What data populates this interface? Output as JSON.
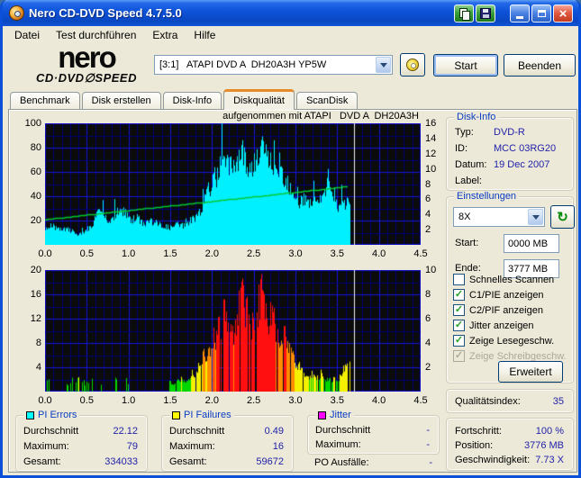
{
  "window": {
    "title": "Nero CD-DVD Speed 4.7.5.0"
  },
  "menu": {
    "items": [
      "Datei",
      "Test durchführen",
      "Extra",
      "Hilfe"
    ]
  },
  "header": {
    "logo_line1": "nero",
    "logo_line2": "CD·DVD∅SPEED",
    "drive_value": "[3:1]   ATAPI DVD A  DH20A3H YP5W",
    "start_label": "Start",
    "quit_label": "Beenden"
  },
  "tabs": [
    "Benchmark",
    "Disk erstellen",
    "Disk-Info",
    "Diskqualität",
    "ScanDisk"
  ],
  "active_tab": "Diskqualität",
  "charts_header": "aufgenommen mit ATAPI   DVD A  DH20A3H",
  "disk_info": {
    "title": "Disk-Info",
    "rows": [
      {
        "label": "Typ:",
        "value": "DVD-R"
      },
      {
        "label": "ID:",
        "value": "MCC 03RG20"
      },
      {
        "label": "Datum:",
        "value": "19 Dec 2007"
      },
      {
        "label": "Label:",
        "value": ""
      }
    ]
  },
  "settings": {
    "title": "Einstellungen",
    "speed_value": "8X",
    "start_label": "Start:",
    "start_value": "0000 MB",
    "end_label": "Ende:",
    "end_value": "3777 MB",
    "checkboxes": [
      {
        "label": "Schnelles Scannen",
        "checked": false,
        "disabled": false
      },
      {
        "label": "C1/PIE anzeigen",
        "checked": true,
        "disabled": false
      },
      {
        "label": "C2/PIF anzeigen",
        "checked": true,
        "disabled": false
      },
      {
        "label": "Jitter anzeigen",
        "checked": true,
        "disabled": false
      },
      {
        "label": "Zeige Lesegeschw.",
        "checked": true,
        "disabled": false
      },
      {
        "label": "Zeige Schreibgeschw.",
        "checked": true,
        "disabled": true
      }
    ],
    "advanced_label": "Erweitert"
  },
  "quality": {
    "label": "Qualitätsindex:",
    "value": "35"
  },
  "progress": {
    "rows": [
      {
        "label": "Fortschritt:",
        "value": "100 %"
      },
      {
        "label": "Position:",
        "value": "3776 MB"
      },
      {
        "label": "Geschwindigkeit:",
        "value": "7.73 X"
      }
    ]
  },
  "stats": {
    "pi_errors": {
      "title": "PI Errors",
      "color": "#00FFFF",
      "rows": [
        {
          "label": "Durchschnitt",
          "value": "22.12"
        },
        {
          "label": "Maximum:",
          "value": "79"
        },
        {
          "label": "Gesamt:",
          "value": "334033"
        }
      ]
    },
    "pi_failures": {
      "title": "PI Failures",
      "color": "#FFFF00",
      "rows": [
        {
          "label": "Durchschnitt",
          "value": "0.49"
        },
        {
          "label": "Maximum:",
          "value": "16"
        },
        {
          "label": "Gesamt:",
          "value": "59672"
        }
      ]
    },
    "jitter": {
      "title": "Jitter",
      "color": "#FF00FF",
      "rows": [
        {
          "label": "Durchschnitt",
          "value": "-"
        },
        {
          "label": "Maximum:",
          "value": "-"
        }
      ]
    },
    "po_label": "PO Ausfälle:",
    "po_value": "-"
  },
  "chart_data": [
    {
      "id": "pie",
      "type": "area",
      "series_name": "PI Errors",
      "title": "aufgenommen mit ATAPI   DVD A  DH20A3H",
      "xlim": [
        0,
        4.5
      ],
      "x_step": 0.05,
      "x_data_end": 3.65,
      "x_ticks": [
        "0.0",
        "0.5",
        "1.0",
        "1.5",
        "2.0",
        "2.5",
        "3.0",
        "3.5",
        "4.0",
        "4.5"
      ],
      "ylim": [
        0,
        100
      ],
      "y_ticks_left": [
        100,
        80,
        60,
        40,
        20
      ],
      "y2lim": [
        0,
        16
      ],
      "y_ticks_right": [
        16,
        14,
        12,
        10,
        8,
        6,
        4,
        2
      ],
      "values": [
        14,
        13,
        15,
        13,
        12,
        13,
        12,
        10,
        8,
        10,
        13,
        15,
        22,
        28,
        24,
        21,
        22,
        25,
        30,
        26,
        22,
        21,
        22,
        19,
        18,
        20,
        19,
        17,
        16,
        15,
        14,
        16,
        17,
        16,
        18,
        20,
        23,
        28,
        35,
        44,
        52,
        57,
        63,
        66,
        61,
        67,
        72,
        78,
        71,
        64,
        67,
        71,
        79,
        73,
        68,
        66,
        63,
        58,
        54,
        46,
        41,
        36,
        38,
        34,
        37,
        33,
        36,
        44,
        57,
        37,
        31,
        30,
        35,
        31
      ],
      "speed_line": {
        "name": "Lesegeschwindigkeit",
        "start_x": 0,
        "start_speed": 3.35,
        "end_x": 3.65,
        "end_speed": 7.73
      },
      "marker_x": 3.7,
      "colors": {
        "fill": "#00F0FF",
        "speed": "#00C832",
        "marker": "#F2F2F2",
        "bg": "#0B0B0B",
        "grid_major": "#1414DC",
        "grid_minor": "#000072"
      }
    },
    {
      "id": "pif",
      "type": "bar",
      "series_name": "PI Failures",
      "xlim": [
        0,
        4.5
      ],
      "x_step": 0.05,
      "x_data_end": 3.65,
      "x_ticks": [
        "0.0",
        "0.5",
        "1.0",
        "1.5",
        "2.0",
        "2.5",
        "3.0",
        "3.5",
        "4.0",
        "4.5"
      ],
      "ylim": [
        0,
        20
      ],
      "y_ticks_left": [
        20,
        16,
        12,
        8,
        4
      ],
      "y2lim": [
        0,
        10
      ],
      "y_ticks_right": [
        10,
        8,
        6,
        4,
        2
      ],
      "values": [
        1,
        1,
        0,
        0,
        0,
        1,
        1,
        0,
        2,
        2,
        1,
        1,
        1,
        1,
        0,
        0,
        1,
        1,
        0,
        1,
        2,
        0,
        0,
        0,
        0,
        0,
        0,
        0,
        0,
        1,
        1,
        1,
        2,
        2,
        2,
        3,
        3,
        5,
        6,
        7,
        8,
        9,
        11,
        13,
        10,
        9,
        13,
        15,
        14,
        11,
        12,
        14,
        16,
        14,
        12,
        11,
        10,
        9,
        8,
        6,
        5,
        4,
        3,
        2,
        3,
        2,
        3,
        2,
        2,
        2,
        2,
        3,
        4,
        5
      ],
      "marker_x": 3.7,
      "colors": {
        "low": "#00D700",
        "mid": "#F5F000",
        "high": "#FF8C00",
        "peak": "#FF0F0F",
        "low_max": 2.3,
        "mid_max": 5.4,
        "high_max": 8.4,
        "bg": "#0B0B0B",
        "grid_major": "#1414DC",
        "grid_minor": "#000072",
        "marker": "#F2F2F2"
      }
    }
  ]
}
